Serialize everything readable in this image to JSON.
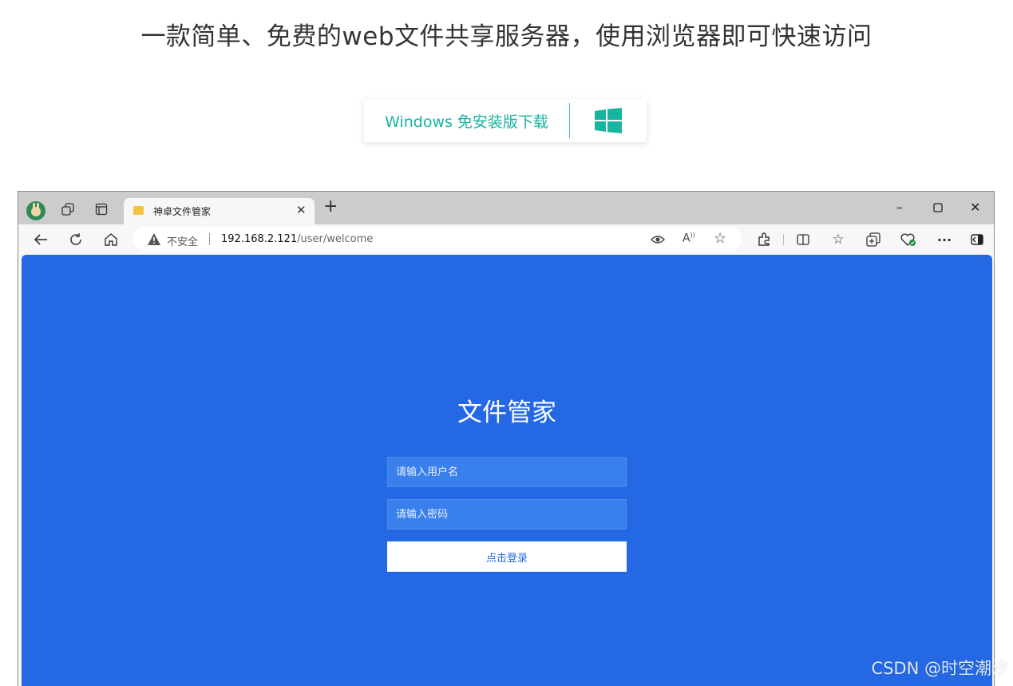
{
  "page": {
    "headline": "一款简单、免费的web文件共享服务器，使用浏览器即可快速访问",
    "download_label": "Windows 免安装版下载",
    "watermark": "CSDN @时空潮汐"
  },
  "browser": {
    "tab": {
      "title": "神卓文件管家"
    },
    "address": {
      "security_label": "不安全",
      "url_host": "192.168.2.121",
      "url_path": "/user/welcome"
    }
  },
  "login": {
    "title": "文件管家",
    "username_placeholder": "请输入用户名",
    "password_placeholder": "请输入密码",
    "submit_label": "点击登录"
  },
  "colors": {
    "accent_teal": "#17b4a0",
    "login_bg": "#2468e4",
    "field_bg": "#3a80ec"
  },
  "icons": {
    "tabbar": [
      "profile-avatar-icon",
      "workspaces-icon",
      "tab-actions-icon"
    ],
    "nav": [
      "back-arrow-icon",
      "refresh-icon",
      "home-icon"
    ],
    "address": [
      "warning-icon",
      "eye-icon",
      "read-aloud-icon",
      "star-icon"
    ],
    "toolbar": [
      "extensions-icon",
      "split-screen-icon",
      "favorites-icon",
      "collections-icon",
      "browser-essentials-icon",
      "more-icon",
      "sidebar-icon"
    ]
  }
}
